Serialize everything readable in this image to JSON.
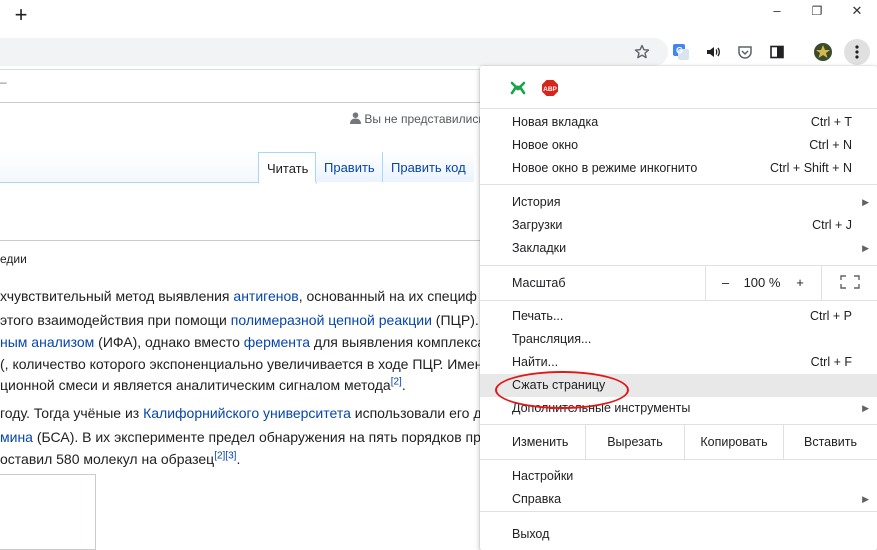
{
  "titlebar": {
    "new_tab_glyph": "+",
    "minimize_glyph": "–",
    "restore_glyph": "❐",
    "close_glyph": "✕"
  },
  "toolbar": {
    "icons": [
      "bookmark-star-icon",
      "google-translate-icon",
      "speaker-icon",
      "pocket-icon",
      "reading-list-icon",
      "profile-avatar-icon",
      "menu-kebab-icon"
    ],
    "translate_letter": "G"
  },
  "wiki": {
    "header_fragment": "–",
    "user_status": "Вы не представились",
    "tabs": [
      {
        "label": "Читать",
        "active": true
      },
      {
        "label": "Править",
        "active": false
      },
      {
        "label": "Править код",
        "active": false
      }
    ],
    "subtitle": "едии",
    "lines": [
      {
        "parts": [
          {
            "t": "хчувствительный метод выявления "
          },
          {
            "t": "антигенов",
            "link": true
          },
          {
            "t": ", основанный на их специф"
          }
        ]
      },
      {
        "parts": [
          {
            "t": "этого взаимодействия при помощи "
          },
          {
            "t": "полимеразной цепной реакции",
            "link": true
          },
          {
            "t": " (ПЦР)."
          }
        ]
      },
      {
        "parts": [
          {
            "t": "ным анализом",
            "link": true
          },
          {
            "t": " (ИФА), однако вместо "
          },
          {
            "t": "фермента",
            "link": true
          },
          {
            "t": " для выявления комплекса"
          }
        ]
      },
      {
        "parts": [
          {
            "t": "(, количество которого экспоненциально увеличивается в ходе ПЦР. Имен"
          }
        ]
      },
      {
        "parts": [
          {
            "t": "ционной смеси и является аналитическим сигналом метода"
          },
          {
            "t": "[2]",
            "sup": true
          },
          {
            "t": "."
          }
        ]
      },
      {
        "parts": [
          {
            "t": "году. Тогда учёные из "
          },
          {
            "t": "Калифорнийского университета",
            "link": true
          },
          {
            "t": " использовали его д"
          }
        ]
      },
      {
        "parts": [
          {
            "t": "мина",
            "link": true
          },
          {
            "t": " (БСА). В их эксперименте предел обнаружения на пять порядков пр"
          }
        ]
      },
      {
        "parts": [
          {
            "t": "оставил 580 молекул на образец"
          },
          {
            "t": "[2][3]",
            "sup": true
          },
          {
            "t": "."
          }
        ]
      }
    ]
  },
  "menu": {
    "extension_icons": [
      "green-extension-icon",
      "adblock-plus-icon"
    ],
    "abp_label": "ABP",
    "items_group1": [
      {
        "label": "Новая вкладка",
        "shortcut": "Ctrl + T"
      },
      {
        "label": "Новое окно",
        "shortcut": "Ctrl + N"
      },
      {
        "label": "Новое окно в режиме инкогнито",
        "shortcut": "Ctrl + Shift + N"
      }
    ],
    "items_group2": [
      {
        "label": "История",
        "shortcut": "",
        "submenu": true
      },
      {
        "label": "Загрузки",
        "shortcut": "Ctrl + J",
        "submenu": false
      },
      {
        "label": "Закладки",
        "shortcut": "",
        "submenu": true
      }
    ],
    "zoom": {
      "label": "Масштаб",
      "minus": "–",
      "value": "100 %",
      "plus": "+"
    },
    "items_group3": [
      {
        "label": "Печать...",
        "shortcut": "Ctrl + P",
        "submenu": false,
        "highlight": false
      },
      {
        "label": "Трансляция...",
        "shortcut": "",
        "submenu": false,
        "highlight": false
      },
      {
        "label": "Найти...",
        "shortcut": "Ctrl + F",
        "submenu": false,
        "highlight": false
      },
      {
        "label": "Сжать страницу",
        "shortcut": "",
        "submenu": false,
        "highlight": true
      },
      {
        "label": "Дополнительные инструменты",
        "shortcut": "",
        "submenu": true,
        "highlight": false
      }
    ],
    "edit": {
      "label": "Изменить",
      "cut": "Вырезать",
      "copy": "Копировать",
      "paste": "Вставить"
    },
    "items_group4": [
      {
        "label": "Настройки",
        "submenu": false
      },
      {
        "label": "Справка",
        "submenu": true
      }
    ],
    "exit": {
      "label": "Выход"
    },
    "annotation_color": "#e01818"
  }
}
